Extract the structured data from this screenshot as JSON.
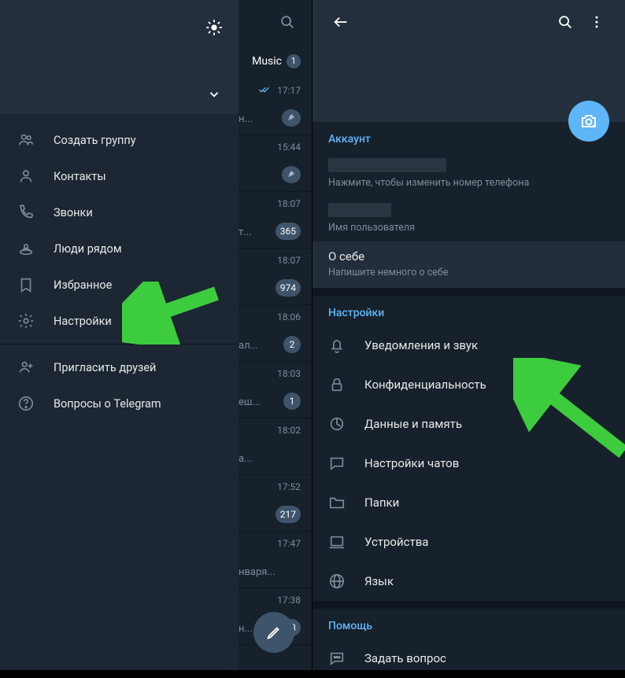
{
  "left": {
    "drawer": {
      "items": [
        {
          "icon": "group",
          "label": "Создать группу"
        },
        {
          "icon": "person",
          "label": "Контакты"
        },
        {
          "icon": "phone",
          "label": "Звонки"
        },
        {
          "icon": "nearby",
          "label": "Люди рядом"
        },
        {
          "icon": "bookmark",
          "label": "Избранное"
        },
        {
          "icon": "settings",
          "label": "Настройки"
        }
      ],
      "secondary": [
        {
          "icon": "invite",
          "label": "Пригласить друзей"
        },
        {
          "icon": "help",
          "label": "Вопросы о Telegram"
        }
      ]
    },
    "strip": {
      "tab_label": "Music",
      "tab_badge": "1",
      "chats": [
        {
          "time": "17:17",
          "snippet": "н...",
          "badge": "",
          "pin": true,
          "checks": true
        },
        {
          "time": "15:44",
          "snippet": "",
          "badge": "",
          "pin": true
        },
        {
          "time": "18:07",
          "snippet": "т...",
          "badge": "365"
        },
        {
          "time": "18:07",
          "snippet": "",
          "badge": "974"
        },
        {
          "time": "18:06",
          "snippet": "ал...",
          "badge": "2"
        },
        {
          "time": "18:03",
          "snippet": "еш...",
          "badge": "1"
        },
        {
          "time": "18:02",
          "snippet": "а...",
          "badge": ""
        },
        {
          "time": "17:52",
          "snippet": "",
          "badge": "217"
        },
        {
          "time": "17:47",
          "snippet": "нваря...",
          "badge": ""
        },
        {
          "time": "17:38",
          "snippet": "н...",
          "badge": "13"
        }
      ]
    }
  },
  "right": {
    "account": {
      "title": "Аккаунт",
      "phone_hint": "Нажмите, чтобы изменить номер телефона",
      "username_hint": "Имя пользователя",
      "about_label": "О себе",
      "about_hint": "Напишите немного о себе"
    },
    "settings": {
      "title": "Настройки",
      "items": [
        {
          "icon": "bell",
          "label": "Уведомления и звук"
        },
        {
          "icon": "lock",
          "label": "Конфиденциальность"
        },
        {
          "icon": "data",
          "label": "Данные и память"
        },
        {
          "icon": "chat",
          "label": "Настройки чатов"
        },
        {
          "icon": "folder",
          "label": "Папки"
        },
        {
          "icon": "devices",
          "label": "Устройства"
        },
        {
          "icon": "globe",
          "label": "Язык"
        }
      ]
    },
    "help": {
      "title": "Помощь",
      "item": "Задать вопрос"
    }
  }
}
